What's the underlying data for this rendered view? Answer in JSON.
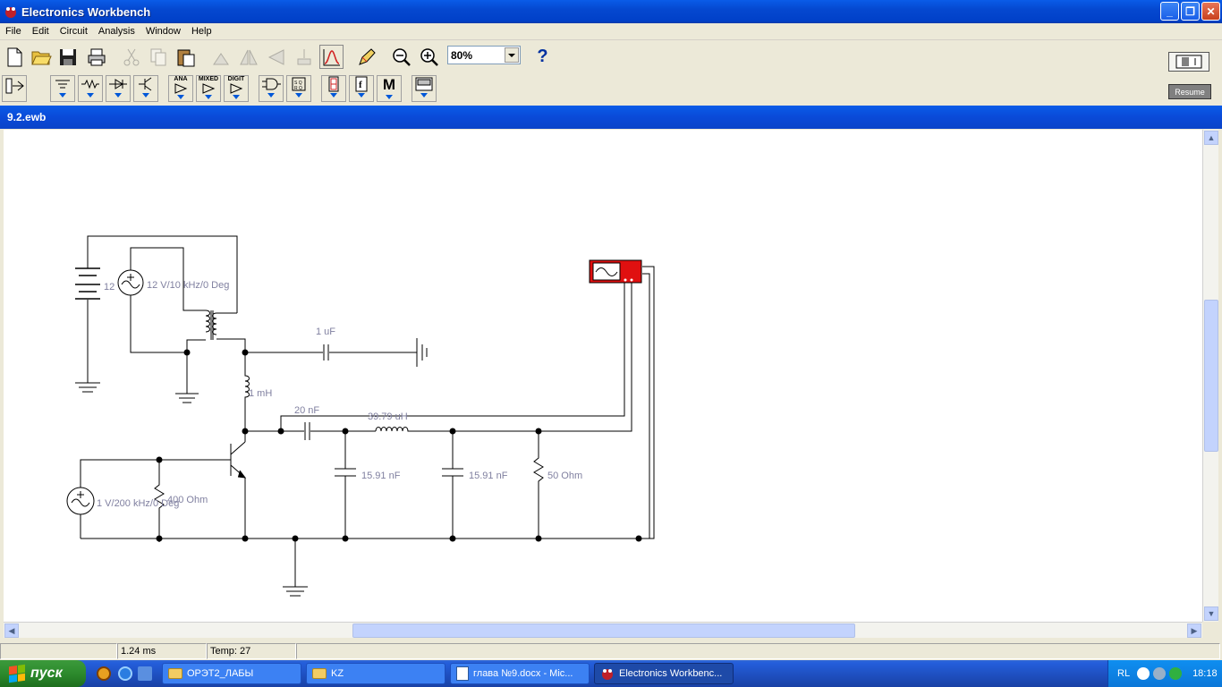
{
  "app": {
    "title": "Electronics Workbench"
  },
  "menu": [
    "File",
    "Edit",
    "Circuit",
    "Analysis",
    "Window",
    "Help"
  ],
  "toolbar": {
    "zoom_value": "80%",
    "help_label": "?",
    "resume_label": "Resume"
  },
  "parts_bin": [
    {
      "name": "sources",
      "label": ""
    },
    {
      "name": "basic",
      "label": ""
    },
    {
      "name": "diodes",
      "label": ""
    },
    {
      "name": "transistors",
      "label": ""
    },
    {
      "name": "analog-ics",
      "label": "ANA"
    },
    {
      "name": "mixed-ics",
      "label": "MIXED"
    },
    {
      "name": "digital-ics",
      "label": "DIGIT"
    },
    {
      "name": "logic-gates",
      "label": ""
    },
    {
      "name": "digital",
      "label": ""
    },
    {
      "name": "indicators",
      "label": ""
    },
    {
      "name": "controls",
      "label": ""
    },
    {
      "name": "miscellaneous",
      "label": "M"
    },
    {
      "name": "instruments",
      "label": ""
    }
  ],
  "document": {
    "title": "9.2.ewb"
  },
  "circuit": {
    "labels": {
      "dc_source": "12",
      "ac_source_1": "12 V/10 kHz/0 Deg",
      "capacitor_1": "1 uF",
      "inductor_1": "1 mH",
      "capacitor_2": "20 nF",
      "inductor_2": "39.79 uH",
      "capacitor_3": "15.91 nF",
      "capacitor_4": "15.91 nF",
      "resistor_load": "50  Ohm",
      "ac_source_2": "1 V/200 kHz/0 Deg",
      "resistor_bias": "400  Ohm"
    }
  },
  "status": {
    "cell1": "",
    "time": "1.24 ms",
    "temp": "Temp:  27",
    "cell4": ""
  },
  "taskbar": {
    "start_label": "пуск",
    "tasks": [
      {
        "label": "ОРЭТ2_ЛАБЫ",
        "icon": "folder-icon"
      },
      {
        "label": "KZ",
        "icon": "folder-icon"
      },
      {
        "label": "глава №9.docx - Mic...",
        "icon": "word-icon"
      },
      {
        "label": "Electronics Workbenc...",
        "icon": "ewb-icon"
      }
    ],
    "tray_lang": "RL",
    "clock": "18:18"
  }
}
